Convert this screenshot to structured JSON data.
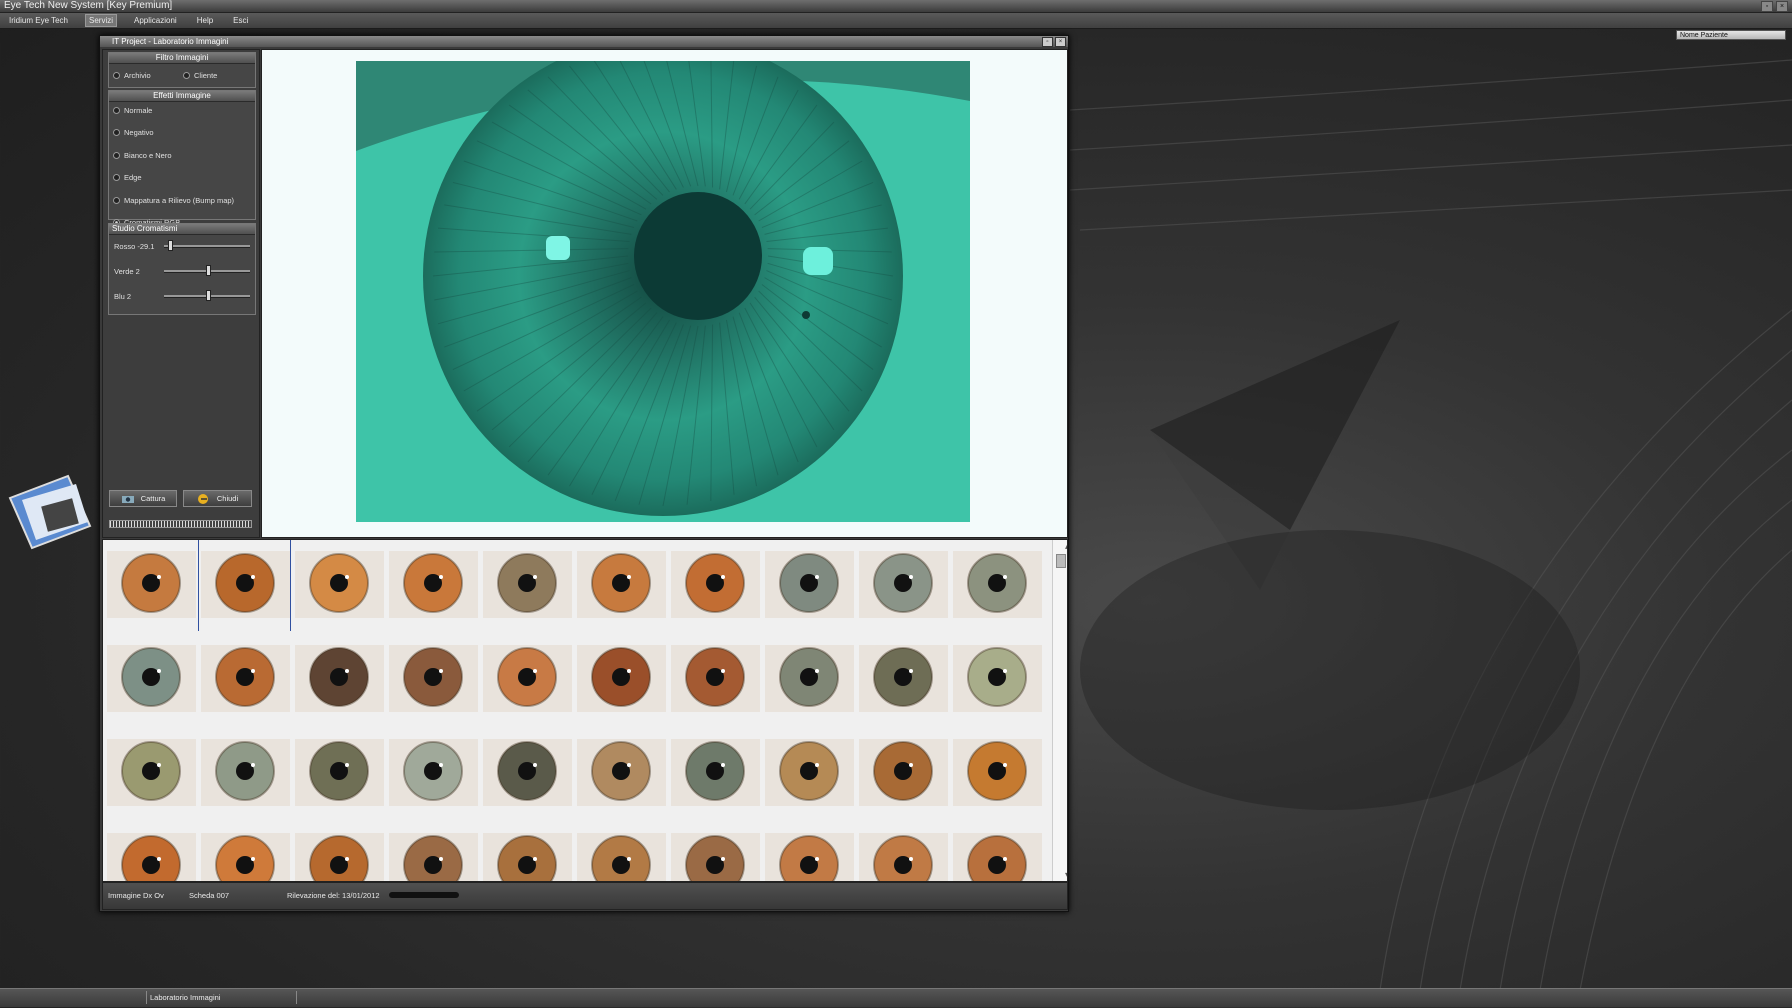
{
  "app": {
    "title": "Eye Tech New System [Key Premium]",
    "menu": [
      "Iridium Eye Tech",
      "Servizi",
      "Applicazioni",
      "Help",
      "Esci"
    ],
    "active_menu": "Servizi",
    "user_box": "Nome Paziente"
  },
  "window": {
    "title": "IT Project - Laboratorio Immagini",
    "btn_restore": "▫",
    "btn_close": "×"
  },
  "filtro": {
    "title": "Filtro Immagini",
    "options": [
      "Archivio",
      "Cliente"
    ],
    "selected": -1
  },
  "effetti": {
    "title": "Effetti Immagine",
    "options": [
      "Normale",
      "Negativo",
      "Bianco e Nero",
      "Edge",
      "Mappatura a Rilievo (Bump map)",
      "Cromatismi RGB"
    ],
    "selected": 5
  },
  "studio": {
    "title": "Studio Cromatismi",
    "sliders": [
      {
        "label": "Rosso -29.1",
        "value": 0.05
      },
      {
        "label": "Verde 2",
        "value": 0.52
      },
      {
        "label": "Blu 2",
        "value": 0.52
      }
    ]
  },
  "buttons": {
    "capture": "Cattura",
    "close": "Chiudi"
  },
  "thumbnail_colors": [
    [
      "#c57a3f",
      "#b8682c",
      "#d48a45",
      "#c9783a",
      "#8e7a5c",
      "#c77a3e",
      "#c26d33",
      "#7f8a80",
      "#8a9488",
      "#8c927f"
    ],
    [
      "#7d9086",
      "#b96a33",
      "#5e4433",
      "#8a5a3c",
      "#c87a45",
      "#9a4f2a",
      "#a45a32",
      "#7f8675",
      "#6e6d55",
      "#a8ad8a"
    ],
    [
      "#9a9a70",
      "#8f9a88",
      "#6f6f55",
      "#a0a99a",
      "#5a5a4a",
      "#b08a60",
      "#6e7a6a",
      "#b58a55",
      "#a86a35",
      "#c57a30"
    ],
    [
      "#c26a2e",
      "#cf7a3a",
      "#b6692e",
      "#9a6a45",
      "#a8703d",
      "#b27a45",
      "#9a6a45",
      "#c27a45",
      "#c07a45",
      "#b8703d"
    ]
  ],
  "status": {
    "left": "Immagine Dx Ov",
    "scheda": "Scheda 007",
    "rilevazione": "Rilevazione del: 13/01/2012"
  },
  "taskbar": {
    "item": "Laboratorio Immagini"
  },
  "colors": {
    "accent_teal": "#3fbfa5",
    "window_bg": "#3a3a3a",
    "viewer_bg": "#f3fbfb"
  }
}
